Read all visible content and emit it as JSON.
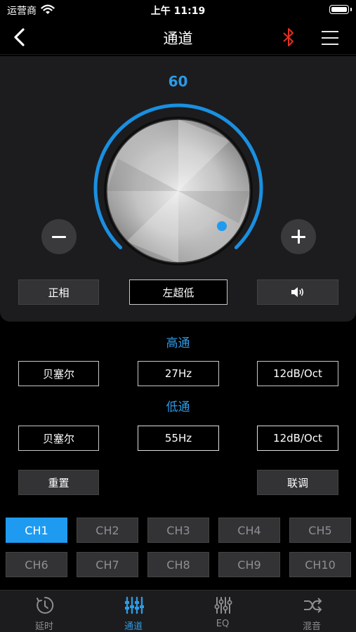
{
  "status_bar": {
    "carrier": "运营商",
    "time": "上午 11:19"
  },
  "nav": {
    "title": "通道"
  },
  "volume": {
    "value": "60"
  },
  "controls": {
    "phase_label": "正相",
    "channel_name": "左超低"
  },
  "high_pass": {
    "title": "高通",
    "filter_type": "贝塞尔",
    "frequency": "27Hz",
    "slope": "12dB/Oct"
  },
  "low_pass": {
    "title": "低通",
    "filter_type": "贝塞尔",
    "frequency": "55Hz",
    "slope": "12dB/Oct"
  },
  "actions": {
    "reset_label": "重置",
    "link_label": "联调"
  },
  "channels": [
    "CH1",
    "CH2",
    "CH3",
    "CH4",
    "CH5",
    "CH6",
    "CH7",
    "CH8",
    "CH9",
    "CH10"
  ],
  "active_channel": "CH1",
  "tabs": [
    {
      "label": "延时",
      "icon": "clock-icon"
    },
    {
      "label": "通道",
      "icon": "channel-sliders-icon"
    },
    {
      "label": "EQ",
      "icon": "eq-sliders-icon"
    },
    {
      "label": "混音",
      "icon": "shuffle-icon"
    }
  ],
  "active_tab": "通道",
  "colors": {
    "accent": "#2b9be6",
    "bluetooth": "#e0301e",
    "panel": "#1c1c1e",
    "button": "#333335"
  }
}
